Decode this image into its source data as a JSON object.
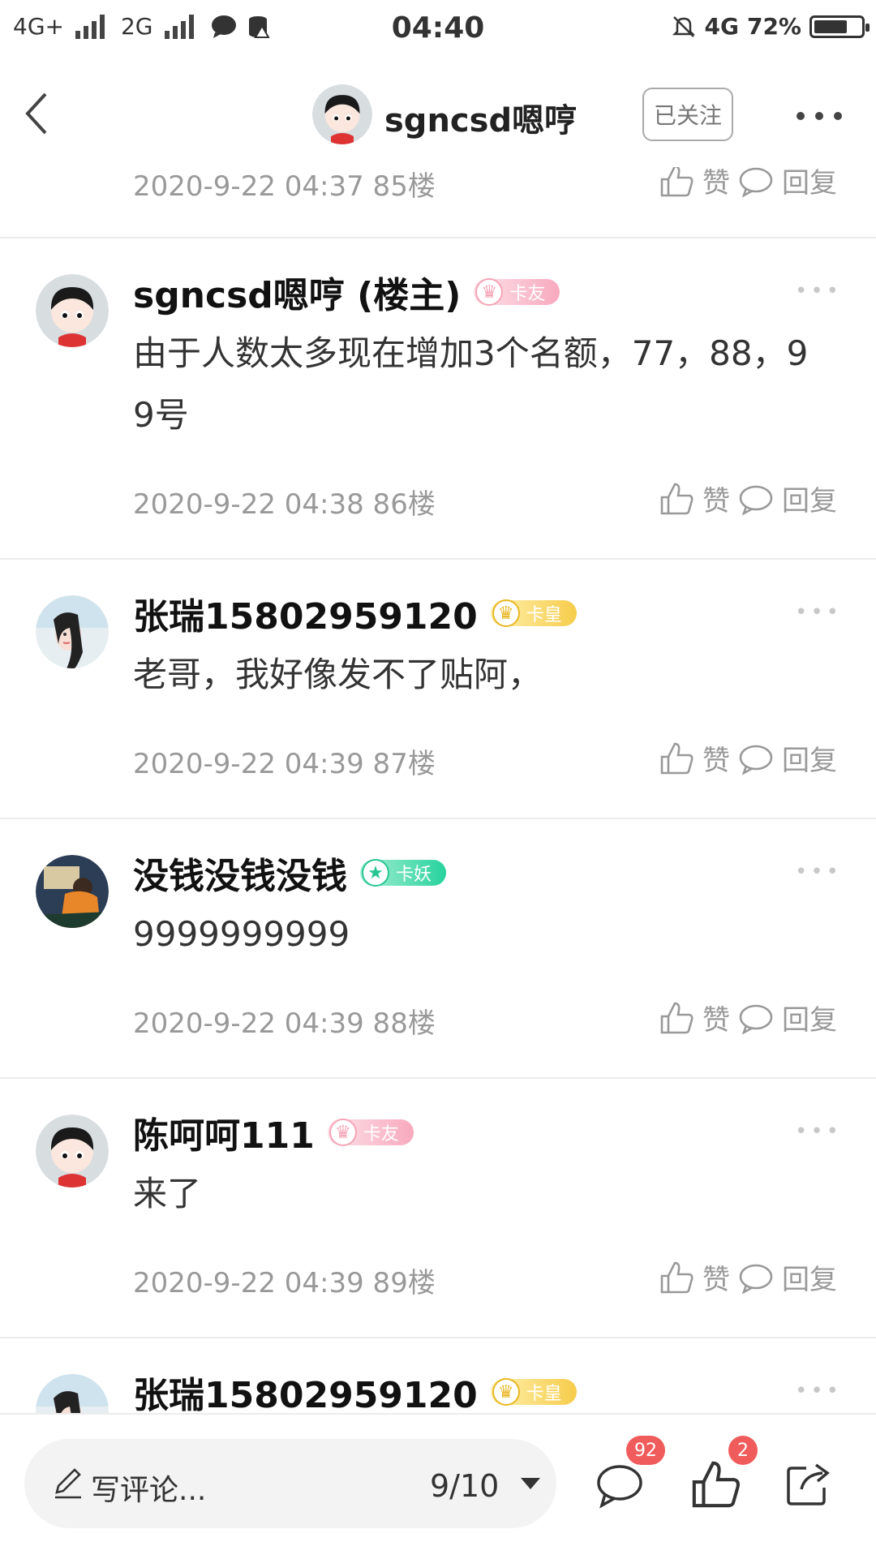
{
  "status_bar": {
    "carrier1": "4G+",
    "carrier2": "2G",
    "time": "04:40",
    "network_right": "4G",
    "battery": "72%",
    "battery_level": 0.72
  },
  "header": {
    "name": "sgncsd嗯哼",
    "follow_label": "已关注"
  },
  "partial_row": {
    "meta": "2020-9-22 04:37  85楼",
    "like_label": "赞",
    "reply_label": "回复"
  },
  "posts": [
    {
      "name": "sgncsd嗯哼 (楼主)",
      "badge": "卡友",
      "content": "由于人数太多现在增加3个名额，77，88，99号",
      "meta": "2020-9-22 04:38  86楼",
      "like_label": "赞",
      "reply_label": "回复"
    },
    {
      "name": "张瑞15802959120",
      "badge": "卡皇",
      "content": "老哥，我好像发不了贴阿，",
      "meta": "2020-9-22 04:39  87楼",
      "like_label": "赞",
      "reply_label": "回复"
    },
    {
      "name": "没钱没钱没钱",
      "badge": "卡妖",
      "content": "9999999999",
      "meta": "2020-9-22 04:39  88楼",
      "like_label": "赞",
      "reply_label": "回复"
    },
    {
      "name": "陈呵呵111",
      "badge": "卡友",
      "content": "来了",
      "meta": "2020-9-22 04:39  89楼",
      "like_label": "赞",
      "reply_label": "回复"
    },
    {
      "name": "张瑞15802959120",
      "badge": "卡皇"
    }
  ],
  "bottom_bar": {
    "comment_placeholder": "写评论...",
    "page": "9/10",
    "comment_count": "92",
    "like_count": "2"
  }
}
